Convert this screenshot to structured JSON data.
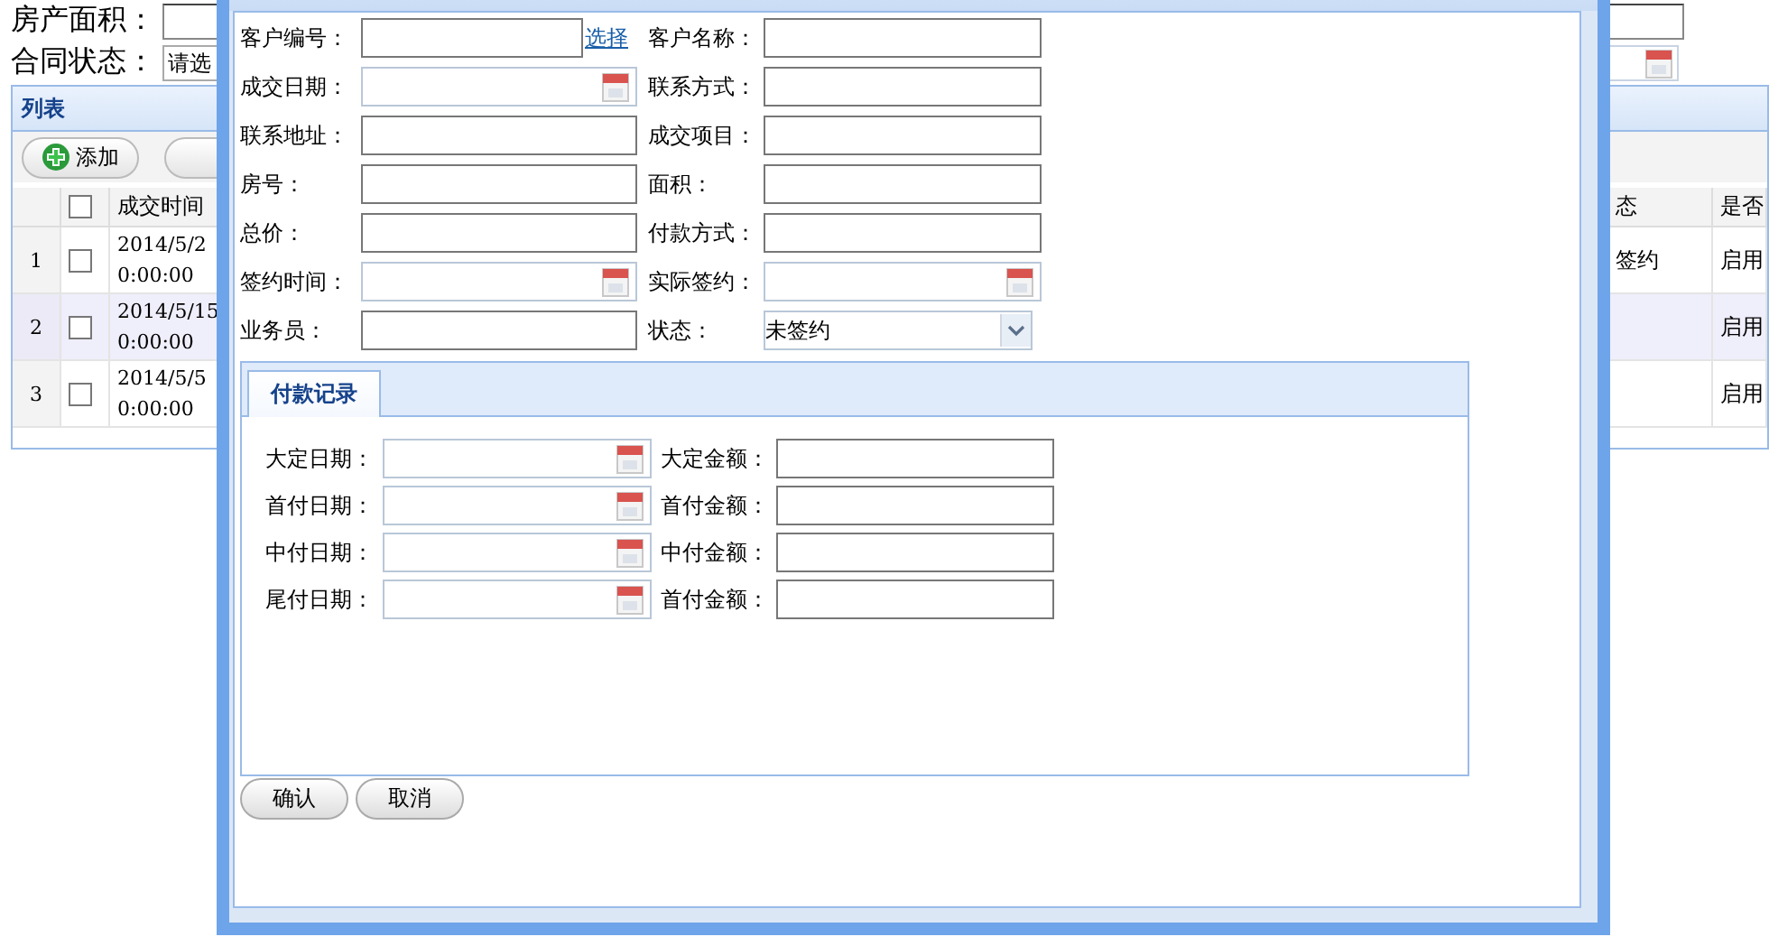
{
  "filters": [
    {
      "label": "房产面积：",
      "kind": "text"
    },
    {
      "label": "合同状态：",
      "kind": "select",
      "value": "请选"
    }
  ],
  "list": {
    "title": "列表",
    "toolbar": [
      {
        "kind": "add",
        "label": "添加"
      },
      {
        "kind": "plain"
      }
    ],
    "columns": [
      {
        "kind": "checkbox",
        "checked": false
      },
      {
        "kind": "text",
        "label": "成交时间"
      }
    ],
    "right_columns": [
      "态",
      "是否"
    ],
    "rows": [
      {
        "index": "1",
        "checked": false,
        "selected": false,
        "time": "2014/5/2 0:00:00",
        "status": "签约",
        "enabled": "启用"
      },
      {
        "index": "2",
        "checked": false,
        "selected": true,
        "time": "2014/5/15 0:00:00",
        "enabled": "启用"
      },
      {
        "index": "3",
        "checked": false,
        "selected": false,
        "time": "2014/5/5 0:00:00",
        "enabled": "启用"
      }
    ]
  },
  "dialog": {
    "form": [
      [
        {
          "label": "客户编号：",
          "kind": "text",
          "link": "选择"
        },
        {
          "label": "客户名称：",
          "kind": "text"
        }
      ],
      [
        {
          "label": "成交日期：",
          "kind": "date"
        },
        {
          "label": "联系方式：",
          "kind": "text"
        }
      ],
      [
        {
          "label": "联系地址：",
          "kind": "text"
        },
        {
          "label": "成交项目：",
          "kind": "text"
        }
      ],
      [
        {
          "label": "房号：",
          "kind": "text"
        },
        {
          "label": "面积：",
          "kind": "text"
        }
      ],
      [
        {
          "label": "总价：",
          "kind": "text"
        },
        {
          "label": "付款方式：",
          "kind": "text"
        }
      ],
      [
        {
          "label": "签约时间：",
          "kind": "date"
        },
        {
          "label": "实际签约：",
          "kind": "date"
        }
      ],
      [
        {
          "label": "业务员：",
          "kind": "text"
        },
        {
          "label": "状态：",
          "kind": "select",
          "value": "未签约"
        }
      ]
    ],
    "tabs": [
      {
        "label": "付款记录",
        "selected": true
      }
    ],
    "payments": [
      [
        {
          "label": "大定日期：",
          "kind": "date"
        },
        {
          "label": "大定金额：",
          "kind": "text"
        }
      ],
      [
        {
          "label": "首付日期：",
          "kind": "date"
        },
        {
          "label": "首付金额：",
          "kind": "text"
        }
      ],
      [
        {
          "label": "中付日期：",
          "kind": "date"
        },
        {
          "label": "中付金额：",
          "kind": "text"
        }
      ],
      [
        {
          "label": "尾付日期：",
          "kind": "date"
        },
        {
          "label": "首付金额：",
          "kind": "text"
        }
      ]
    ],
    "buttons": [
      "确认",
      "取消"
    ]
  }
}
